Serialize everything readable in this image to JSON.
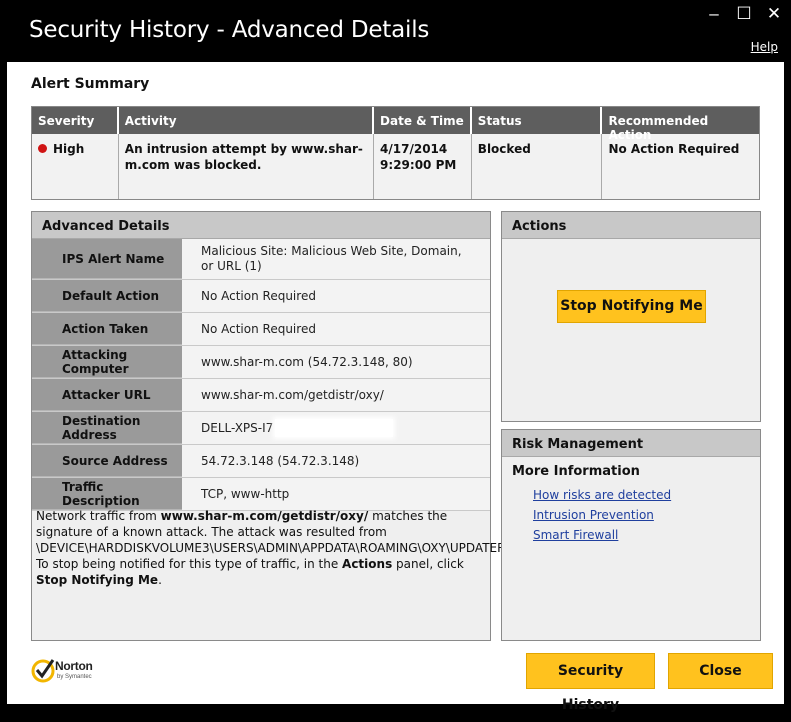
{
  "window": {
    "title": "Security History - Advanced Details",
    "help_label": "Help",
    "controls": {
      "minimize": "‒",
      "maximize": "☐",
      "close": "✕"
    }
  },
  "alert_summary": {
    "heading": "Alert Summary",
    "columns": [
      "Severity",
      "Activity",
      "Date & Time",
      "Status",
      "Recommended Action"
    ],
    "row": {
      "severity": "High",
      "severity_color": "#d01414",
      "activity": "An intrusion attempt by www.shar-m.com was blocked.",
      "date": "4/17/2014",
      "time": "9:29:00 PM",
      "status": "Blocked",
      "recommended_action": "No Action Required"
    }
  },
  "advanced_details": {
    "heading": "Advanced Details",
    "rows": [
      {
        "label": "IPS Alert Name",
        "value": "Malicious Site: Malicious Web Site, Domain, or URL (1)"
      },
      {
        "label": "Default Action",
        "value": "No Action Required"
      },
      {
        "label": "Action Taken",
        "value": "No Action Required"
      },
      {
        "label": "Attacking Computer",
        "value": "www.shar-m.com (54.72.3.148, 80)"
      },
      {
        "label": "Attacker URL",
        "value": "www.shar-m.com/getdistr/oxy/"
      },
      {
        "label": "Destination Address",
        "value": "DELL-XPS-I7"
      },
      {
        "label": "Source Address",
        "value": "54.72.3.148 (54.72.3.148)"
      },
      {
        "label": "Traffic Description",
        "value": "TCP, www-http"
      }
    ],
    "description": {
      "p1": "Network traffic from ",
      "url": "www.shar-m.com/getdistr/oxy/",
      "p2": " matches the signature of a known attack. The attack was resulted from \\DEVICE\\HARDDISKVOLUME3\\USERS\\ADMIN\\APPDATA\\ROAMING\\OXY\\UPDATER.EXE. To stop being notified for this type of traffic, in the ",
      "actions_word": "Actions",
      "p3": " panel, click ",
      "stop_word": "Stop Notifying Me",
      "p4": "."
    }
  },
  "actions_panel": {
    "heading": "Actions",
    "stop_button": "Stop Notifying Me"
  },
  "risk_panel": {
    "heading": "Risk Management",
    "subheading": "More Information",
    "links": [
      "How risks are detected",
      "Intrusion Prevention",
      "Smart Firewall"
    ]
  },
  "footer": {
    "logo_name": "Norton",
    "logo_sub": "by Symantec",
    "security_history_button": "Security History",
    "close_button": "Close",
    "accent_color": "#ffc21e"
  }
}
